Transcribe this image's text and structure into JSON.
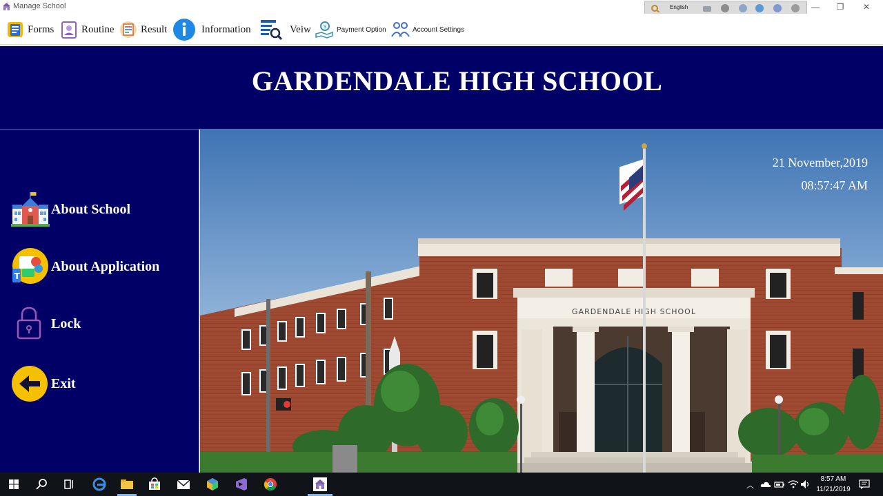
{
  "window": {
    "title": "Manage School",
    "minimize_glyph": "—",
    "restore_glyph": "❐",
    "close_glyph": "✕"
  },
  "langbar": {
    "language": "English"
  },
  "menu": {
    "items": [
      {
        "label": "Forms",
        "icon": "forms-icon"
      },
      {
        "label": "Routine",
        "icon": "routine-icon"
      },
      {
        "label": "Result",
        "icon": "result-icon"
      },
      {
        "label": "Information",
        "icon": "information-icon"
      },
      {
        "label": "Veiw",
        "icon": "view-icon"
      },
      {
        "label": "Payment Option",
        "icon": "payment-icon"
      },
      {
        "label": "Account Settings",
        "icon": "account-settings-icon"
      }
    ]
  },
  "header": {
    "school_name": "GARDENDALE HIGH SCHOOL"
  },
  "sidebar": {
    "items": [
      {
        "label": "About School",
        "icon": "school-building-icon"
      },
      {
        "label": "About Application",
        "icon": "application-icon"
      },
      {
        "label": "Lock",
        "icon": "padlock-icon"
      },
      {
        "label": "Exit",
        "icon": "exit-arrow-icon"
      }
    ]
  },
  "main": {
    "date": "21 November,2019",
    "time": "08:57:47 AM",
    "building_sign": "GARDENDALE HIGH SCHOOL"
  },
  "taskbar": {
    "clock_time": "8:57 AM",
    "clock_date": "11/21/2019"
  },
  "colors": {
    "navy": "#000066",
    "accent_yellow": "#f5c000",
    "brick": "#9c4530"
  }
}
